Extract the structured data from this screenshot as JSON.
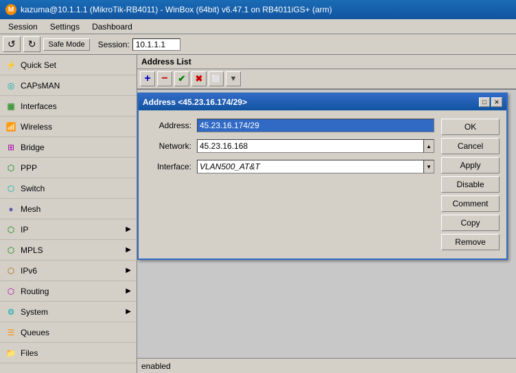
{
  "title_bar": {
    "text": "kazuma@10.1.1.1 (MikroTik-RB4011) - WinBox (64bit) v6.47.1 on RB4011iGS+ (arm)"
  },
  "menu_bar": {
    "items": [
      "Session",
      "Settings",
      "Dashboard"
    ]
  },
  "toolbar": {
    "undo_label": "↺",
    "redo_label": "↻",
    "safe_mode_label": "Safe Mode",
    "session_label": "Session:",
    "session_value": "10.1.1.1"
  },
  "sidebar": {
    "items": [
      {
        "id": "quick-set",
        "label": "Quick Set",
        "icon": "⚡",
        "has_arrow": false
      },
      {
        "id": "capsman",
        "label": "CAPsMAN",
        "icon": "📡",
        "has_arrow": false
      },
      {
        "id": "interfaces",
        "label": "Interfaces",
        "icon": "🔌",
        "has_arrow": false
      },
      {
        "id": "wireless",
        "label": "Wireless",
        "icon": "📶",
        "has_arrow": false
      },
      {
        "id": "bridge",
        "label": "Bridge",
        "icon": "🌉",
        "has_arrow": false
      },
      {
        "id": "ppp",
        "label": "PPP",
        "icon": "🔗",
        "has_arrow": false
      },
      {
        "id": "switch",
        "label": "Switch",
        "icon": "🔀",
        "has_arrow": false
      },
      {
        "id": "mesh",
        "label": "Mesh",
        "icon": "⬡",
        "has_arrow": false
      },
      {
        "id": "ip",
        "label": "IP",
        "icon": "🌐",
        "has_arrow": true
      },
      {
        "id": "mpls",
        "label": "MPLS",
        "icon": "📊",
        "has_arrow": true
      },
      {
        "id": "ipv6",
        "label": "IPv6",
        "icon": "🌍",
        "has_arrow": true
      },
      {
        "id": "routing",
        "label": "Routing",
        "icon": "🔄",
        "has_arrow": true
      },
      {
        "id": "system",
        "label": "System",
        "icon": "⚙",
        "has_arrow": true
      },
      {
        "id": "queues",
        "label": "Queues",
        "icon": "📋",
        "has_arrow": false
      },
      {
        "id": "files",
        "label": "Files",
        "icon": "📁",
        "has_arrow": false
      }
    ]
  },
  "address_list": {
    "title": "Address List",
    "toolbar_buttons": [
      {
        "id": "add",
        "label": "+",
        "title": "Add"
      },
      {
        "id": "remove",
        "label": "−",
        "title": "Remove"
      },
      {
        "id": "check",
        "label": "✓",
        "title": "Enable"
      },
      {
        "id": "cross",
        "label": "✕",
        "title": "Disable"
      },
      {
        "id": "copy",
        "label": "⬜",
        "title": "Copy"
      },
      {
        "id": "filter",
        "label": "▼",
        "title": "Filter"
      }
    ]
  },
  "address_dialog": {
    "title": "Address <45.23.16.174/29>",
    "fields": {
      "address_label": "Address:",
      "address_value": "45.23.16.174/29",
      "network_label": "Network:",
      "network_value": "45.23.16.168",
      "interface_label": "Interface:",
      "interface_value": "VLAN500_AT&T"
    },
    "buttons": {
      "ok": "OK",
      "cancel": "Cancel",
      "apply": "Apply",
      "disable": "Disable",
      "comment": "Comment",
      "copy": "Copy",
      "remove": "Remove"
    }
  },
  "status_bar": {
    "text": "enabled"
  }
}
